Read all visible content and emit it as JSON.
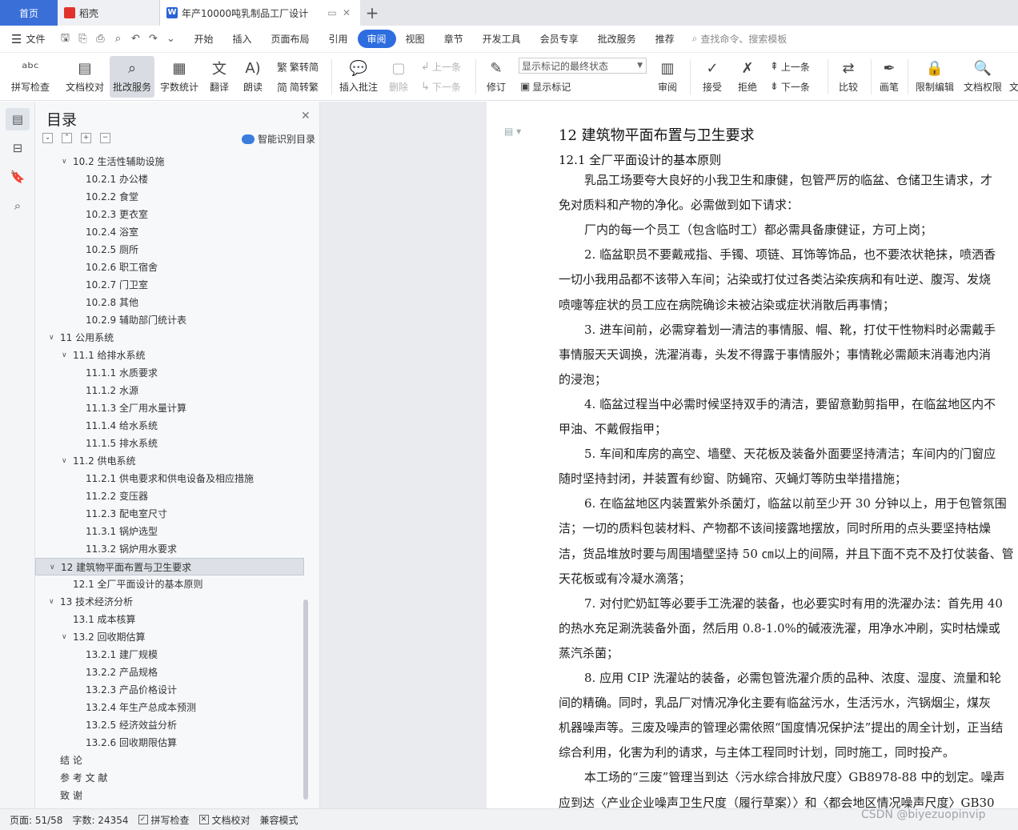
{
  "tabs": {
    "home": "首页",
    "daoke": "稻壳",
    "doc": "年产10000吨乳制品工厂设计",
    "doc_icon": "W"
  },
  "menu": {
    "file": "文件",
    "tabs": [
      "开始",
      "插入",
      "页面布局",
      "引用",
      "审阅",
      "视图",
      "章节",
      "开发工具",
      "会员专享",
      "批改服务",
      "推荐"
    ],
    "active_tab": "审阅",
    "search": "查找命令、搜索模板"
  },
  "ribbon": {
    "spellcheck": "拼写检查",
    "proofread": "文档校对",
    "correction": "批改服务",
    "wordcount": "字数统计",
    "translate": "翻译",
    "read": "朗读",
    "trad": "繁转简",
    "simp": "简转繁",
    "insert_comment": "插入批注",
    "delete": "删除",
    "prev": "上一条",
    "next": "下一条",
    "revise": "修订",
    "markup_state": "显示标记的最终状态",
    "show_markup": "显示标记",
    "review": "审阅",
    "accept": "接受",
    "reject": "拒绝",
    "prev2": "上一条",
    "next2": "下一条",
    "compare": "比较",
    "pen": "画笔",
    "restrict": "限制编辑",
    "rights": "文档权限",
    "more": "文"
  },
  "toc": {
    "title": "目录",
    "smart": "智能识别目录",
    "items": [
      {
        "text": "10.2  生活性辅助设施",
        "level": 2,
        "arrow": "open"
      },
      {
        "text": "10.2.1  办公楼",
        "level": 3
      },
      {
        "text": "10.2.2  食堂",
        "level": 3
      },
      {
        "text": "10.2.3  更衣室",
        "level": 3
      },
      {
        "text": "10.2.4  浴室",
        "level": 3
      },
      {
        "text": "10.2.5  厕所",
        "level": 3
      },
      {
        "text": "10.2.6  职工宿舍",
        "level": 3
      },
      {
        "text": "10.2.7  门卫室",
        "level": 3
      },
      {
        "text": "10.2.8  其他",
        "level": 3
      },
      {
        "text": "10.2.9  辅助部门统计表",
        "level": 3
      },
      {
        "text": "11  公用系统",
        "level": 1,
        "arrow": "open"
      },
      {
        "text": "11.1  给排水系统",
        "level": 2,
        "arrow": "open"
      },
      {
        "text": "11.1.1  水质要求",
        "level": 3
      },
      {
        "text": "11.1.2  水源",
        "level": 3
      },
      {
        "text": "11.1.3  全厂用水量计算",
        "level": 3
      },
      {
        "text": "11.1.4  给水系统",
        "level": 3
      },
      {
        "text": "11.1.5  排水系统",
        "level": 3
      },
      {
        "text": "11.2  供电系统",
        "level": 2,
        "arrow": "open"
      },
      {
        "text": "11.2.1  供电要求和供电设备及相应措施",
        "level": 3
      },
      {
        "text": "11.2.2  变压器",
        "level": 3
      },
      {
        "text": "11.2.3  配电室尺寸",
        "level": 3
      },
      {
        "text": "11.3.1  锅炉选型",
        "level": 3
      },
      {
        "text": "11.3.2  锅炉用水要求",
        "level": 3
      },
      {
        "text": "12  建筑物平面布置与卫生要求",
        "level": 1,
        "arrow": "open",
        "selected": true
      },
      {
        "text": "12.1  全厂平面设计的基本原则",
        "level": 2
      },
      {
        "text": "13  技术经济分析",
        "level": 1,
        "arrow": "open"
      },
      {
        "text": "13.1  成本核算",
        "level": 2
      },
      {
        "text": "13.2 回收期估算",
        "level": 2,
        "arrow": "open"
      },
      {
        "text": "13.2.1  建厂规模",
        "level": 3
      },
      {
        "text": "13.2.2  产品规格",
        "level": 3
      },
      {
        "text": "13.2.3  产品价格设计",
        "level": 3
      },
      {
        "text": "13.2.4  年生产总成本预测",
        "level": 3
      },
      {
        "text": "13.2.5  经济效益分析",
        "level": 3
      },
      {
        "text": "13.2.6  回收期限估算",
        "level": 3
      },
      {
        "text": "结      论",
        "level": 0
      },
      {
        "text": "参 考 文 献",
        "level": 0
      },
      {
        "text": "致      谢",
        "level": 0
      }
    ]
  },
  "doc": {
    "h1": "12  建筑物平面布置与卫生要求",
    "h2": "12.1  全厂平面设计的基本原则",
    "lines": [
      {
        "t": "乳品工场要夸大良好的小我卫生和康健，包管严厉的临盆、仓储卫生请求，才",
        "ind": true
      },
      {
        "t": "免对质料和产物的净化。必需做到如下请求：",
        "ind": false
      },
      {
        "t": "厂内的每一个员工（包含临时工）都必需具备康健证，方可上岗；",
        "ind": true
      },
      {
        "t": "2. 临盆职员不要戴戒指、手镯、项链、耳饰等饰品，也不要浓状艳抹，喷洒香",
        "ind": true
      },
      {
        "t": "一切小我用品都不该带入车间；沾染或打仗过各类沾染疾病和有吐逆、腹泻、发烧",
        "ind": false
      },
      {
        "t": "喷嚏等症状的员工应在病院确诊未被沾染或症状消散后再事情；",
        "ind": false
      },
      {
        "t": "3. 进车间前，必需穿着划一清洁的事情服、帽、靴，打仗干性物料时必需戴手",
        "ind": true
      },
      {
        "t": "事情服天天调换，洗濯消毒，头发不得露于事情服外；事情靴必需颠末消毒池内消",
        "ind": false
      },
      {
        "t": "的浸泡；",
        "ind": false
      },
      {
        "t": "4. 临盆过程当中必需时候坚持双手的清洁，要留意勤剪指甲，在临盆地区内不",
        "ind": true
      },
      {
        "t": "甲油、不戴假指甲；",
        "ind": false
      },
      {
        "t": "5. 车间和库房的高空、墙壁、天花板及装备外面要坚持清洁；车间内的门窗应",
        "ind": true
      },
      {
        "t": "随时坚持封闭，并装置有纱窗、防蝇帘、灭蝇灯等防虫举措措施；",
        "ind": false
      },
      {
        "t": "6. 在临盆地区内装置紫外杀菌灯，临盆以前至少开 30 分钟以上，用于包管氛围",
        "ind": true
      },
      {
        "t": "洁；一切的质料包装材料、产物都不该间接露地摆放，同时所用的点头要坚持枯燥",
        "ind": false
      },
      {
        "t": "洁，货品堆放时要与周围墙壁坚持 50 ㎝以上的间隔，并且下面不克不及打仗装备、管",
        "ind": false
      },
      {
        "t": "天花板或有冷凝水滴落；",
        "ind": false
      },
      {
        "t": "7. 对付贮奶缸等必要手工洗濯的装备，也必要实时有用的洗濯办法：首先用 40",
        "ind": true
      },
      {
        "t": "的热水充足涮洗装备外面，然后用 0.8-1.0%的碱液洗濯，用净水冲刷，实时枯燥或",
        "ind": false
      },
      {
        "t": "蒸汽杀菌；",
        "ind": false
      },
      {
        "t": "8. 应用 CIP 洗濯站的装备，必需包管洗濯介质的品种、浓度、湿度、流量和轮",
        "ind": true
      },
      {
        "t": "间的精确。同时，乳品厂对情况净化主要有临盆污水，生活污水，汽锅烟尘，煤灰",
        "ind": false
      },
      {
        "t": "机器噪声等。三废及噪声的管理必需依照“国度情况保护法”提出的周全计划，正当结",
        "ind": false
      },
      {
        "t": "综合利用，化害为利的请求，与主体工程同时计划，同时施工，同时投产。",
        "ind": false
      },
      {
        "t": "本工场的“三废”管理当到达〈污水综合排放尺度〉GB8978-88 中的划定。噪声",
        "ind": true
      },
      {
        "t": "应到达〈产业企业噪声卫生尺度（履行草案）〉和〈都会地区情况噪声尺度〉GB30",
        "ind": false
      }
    ]
  },
  "status": {
    "page": "页面: 51/58",
    "words": "字数: 24354",
    "spell": "拼写检查",
    "proof": "文档校对",
    "compat": "兼容模式"
  },
  "watermark": "CSDN @biyezuopinvip"
}
